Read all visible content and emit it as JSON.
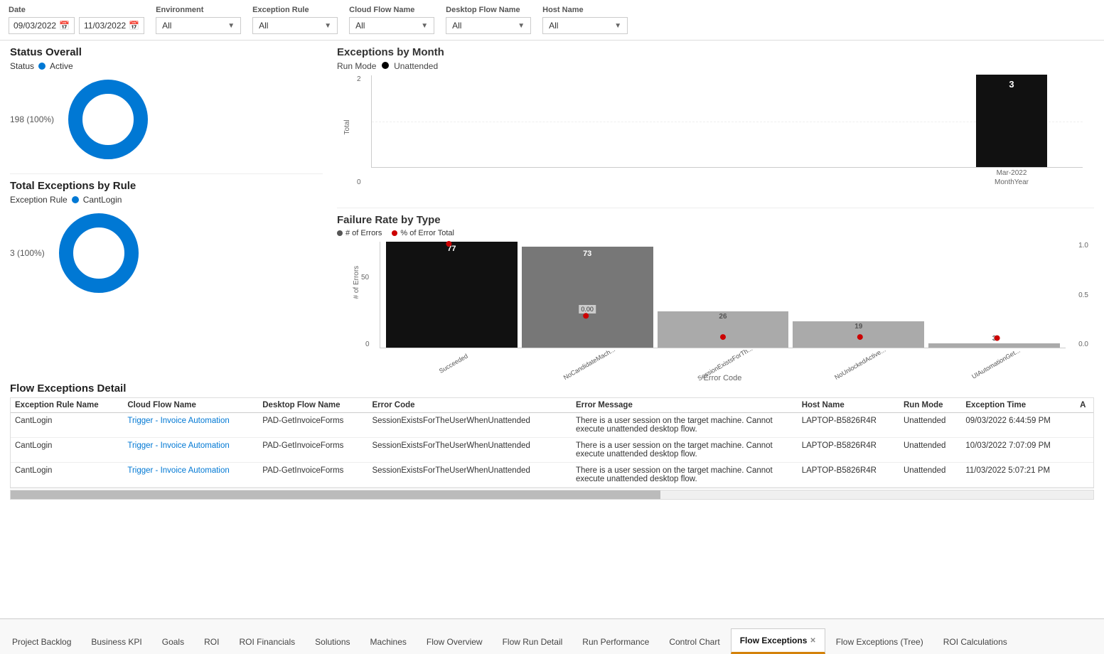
{
  "filters": {
    "date_label": "Date",
    "date_start": "09/03/2022",
    "date_end": "11/03/2022",
    "environment_label": "Environment",
    "environment_value": "All",
    "exception_rule_label": "Exception Rule",
    "exception_rule_value": "All",
    "cloud_flow_name_label": "Cloud Flow Name",
    "cloud_flow_name_value": "All",
    "desktop_flow_name_label": "Desktop Flow Name",
    "desktop_flow_name_value": "All",
    "host_name_label": "Host Name",
    "host_name_value": "All"
  },
  "status_overall": {
    "title": "Status Overall",
    "status_label": "Status",
    "status_value": "Active",
    "donut_label": "198 (100%)",
    "donut_percent": 100
  },
  "exceptions_by_rule": {
    "title": "Total Exceptions by Rule",
    "rule_label": "Exception Rule",
    "rule_value": "CantLogin",
    "donut_label": "3 (100%)",
    "donut_percent": 100
  },
  "exceptions_by_month": {
    "title": "Exceptions by Month",
    "run_mode_label": "Run Mode",
    "run_mode_value": "Unattended",
    "y_labels": [
      "2",
      "",
      "0"
    ],
    "x_label": "MonthYear",
    "bar": {
      "value": "3",
      "month": "Mar-2022"
    }
  },
  "failure_rate": {
    "title": "Failure Rate by Type",
    "legend": [
      {
        "label": "# of Errors",
        "color": "#555"
      },
      {
        "label": "% of Error Total",
        "color": "#c00"
      }
    ],
    "y_label": "# of Errors",
    "x_label": "Error Code",
    "bars": [
      {
        "label": "Succeeded",
        "value": 77,
        "color": "#111",
        "x_tick": "Succeeded"
      },
      {
        "label": "NoCandidateMach...",
        "value": 73,
        "color": "#777",
        "badge": "0.00",
        "x_tick": "NoCandidateMach..."
      },
      {
        "label": "SessionExistsForTh...",
        "value": 26,
        "color": "#aaa",
        "x_tick": "SessionExistsForTh..."
      },
      {
        "label": "NoUnlockedActive...",
        "value": 19,
        "color": "#aaa",
        "x_tick": "NoUnlockedActive..."
      },
      {
        "label": "UIAutomationGet...",
        "value": 3,
        "color": "#aaa",
        "x_tick": "UIAutomationGet..."
      }
    ],
    "y_ticks": [
      "50",
      "0"
    ],
    "right_y_ticks": [
      "1.0",
      "0.5",
      "0.0"
    ]
  },
  "flow_exceptions_detail": {
    "title": "Flow Exceptions Detail",
    "columns": [
      "Exception Rule Name",
      "Cloud Flow Name",
      "Desktop Flow Name",
      "Error Code",
      "Error Message",
      "Host Name",
      "Run Mode",
      "Exception Time",
      "A"
    ],
    "rows": [
      {
        "exception_rule": "CantLogin",
        "cloud_flow": "Trigger - Invoice Automation",
        "desktop_flow": "PAD-GetInvoiceForms",
        "error_code": "SessionExistsForTheUserWhenUnattended",
        "error_message": "There is a user session on the target machine. Cannot execute unattended desktop flow.",
        "host_name": "LAPTOP-B5826R4R",
        "run_mode": "Unattended",
        "exception_time": "09/03/2022 6:44:59 PM"
      },
      {
        "exception_rule": "CantLogin",
        "cloud_flow": "Trigger - Invoice Automation",
        "desktop_flow": "PAD-GetInvoiceForms",
        "error_code": "SessionExistsForTheUserWhenUnattended",
        "error_message": "There is a user session on the target machine. Cannot execute unattended desktop flow.",
        "host_name": "LAPTOP-B5826R4R",
        "run_mode": "Unattended",
        "exception_time": "10/03/2022 7:07:09 PM"
      },
      {
        "exception_rule": "CantLogin",
        "cloud_flow": "Trigger - Invoice Automation",
        "desktop_flow": "PAD-GetInvoiceForms",
        "error_code": "SessionExistsForTheUserWhenUnattended",
        "error_message": "There is a user session on the target machine. Cannot execute unattended desktop flow.",
        "host_name": "LAPTOP-B5826R4R",
        "run_mode": "Unattended",
        "exception_time": "11/03/2022 5:07:21 PM"
      }
    ]
  },
  "tabs": [
    {
      "label": "Project Backlog",
      "active": false
    },
    {
      "label": "Business KPI",
      "active": false
    },
    {
      "label": "Goals",
      "active": false
    },
    {
      "label": "ROI",
      "active": false
    },
    {
      "label": "ROI Financials",
      "active": false
    },
    {
      "label": "Solutions",
      "active": false
    },
    {
      "label": "Machines",
      "active": false
    },
    {
      "label": "Flow Overview",
      "active": false
    },
    {
      "label": "Flow Run Detail",
      "active": false
    },
    {
      "label": "Run Performance",
      "active": false
    },
    {
      "label": "Control Chart",
      "active": false
    },
    {
      "label": "Flow Exceptions",
      "active": true,
      "closable": true
    },
    {
      "label": "Flow Exceptions (Tree)",
      "active": false
    },
    {
      "label": "ROI Calculations",
      "active": false
    }
  ]
}
